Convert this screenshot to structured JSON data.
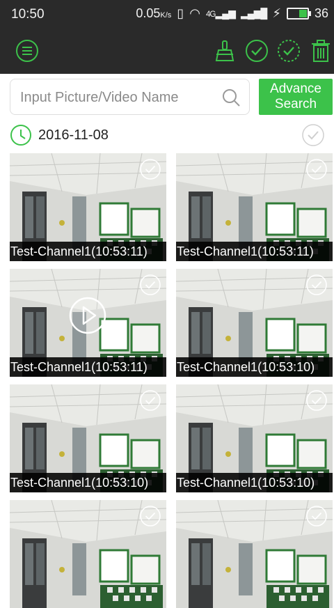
{
  "status_bar": {
    "time": "10:50",
    "net_speed": "0.05",
    "net_speed_unit": "K/s",
    "signal_4g": "4G",
    "battery": "36"
  },
  "toolbar": {
    "menu_icon": "menu-icon",
    "clean_icon": "broom-icon",
    "select_icon": "check-circle-icon",
    "select_all_icon": "dashed-check-circle-icon",
    "delete_icon": "trash-icon",
    "accent": "#3cc24a"
  },
  "search": {
    "placeholder": "Input Picture/Video Name",
    "value": "",
    "advance_line1": "Advance",
    "advance_line2": "Search"
  },
  "group": {
    "date": "2016-11-08"
  },
  "items": [
    {
      "caption": "Test-Channel1(10:53:11)",
      "type": "picture"
    },
    {
      "caption": "Test-Channel1(10:53:11)",
      "type": "picture"
    },
    {
      "caption": "Test-Channel1(10:53:11)",
      "type": "video"
    },
    {
      "caption": "Test-Channel1(10:53:10)",
      "type": "picture"
    },
    {
      "caption": "Test-Channel1(10:53:10)",
      "type": "picture"
    },
    {
      "caption": "Test-Channel1(10:53:10)",
      "type": "picture"
    },
    {
      "caption": "",
      "type": "picture"
    },
    {
      "caption": "",
      "type": "picture"
    }
  ]
}
